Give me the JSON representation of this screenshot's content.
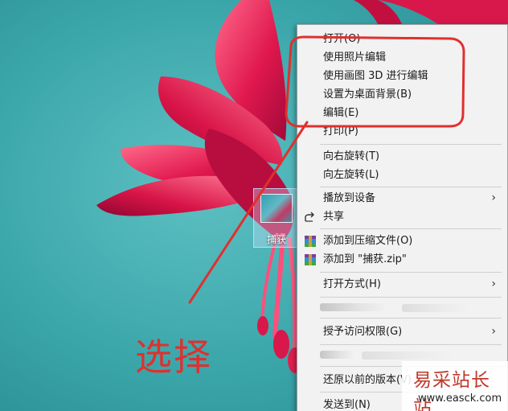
{
  "desktop": {
    "background_color": "#3aa6aa",
    "icon_label": "捕获"
  },
  "context_menu": {
    "items": [
      {
        "label": "打开(O)"
      },
      {
        "label": "使用照片编辑"
      },
      {
        "label": "使用画图 3D 进行编辑"
      },
      {
        "label": "设置为桌面背景(B)"
      },
      {
        "label": "编辑(E)"
      },
      {
        "label": "打印(P)"
      },
      {
        "label": "向右旋转(T)"
      },
      {
        "label": "向左旋转(L)"
      },
      {
        "label": "播放到设备",
        "submenu": "›"
      },
      {
        "label": "共享",
        "icon": "share-icon"
      },
      {
        "label": "添加到压缩文件(O)",
        "icon": "winrar-icon"
      },
      {
        "label": "添加到 \"捕获.zip\"",
        "icon": "winrar-icon"
      },
      {
        "label": "打开方式(H)",
        "submenu": "›"
      },
      {
        "label": "授予访问权限(G)",
        "submenu": "›"
      },
      {
        "label": "还原以前的版本(V)"
      },
      {
        "label": "发送到(N)"
      }
    ]
  },
  "annotation": {
    "label": "选择",
    "color": "#e0302e"
  },
  "watermark": {
    "title": "易采站长站",
    "url": "www.easck.com"
  }
}
